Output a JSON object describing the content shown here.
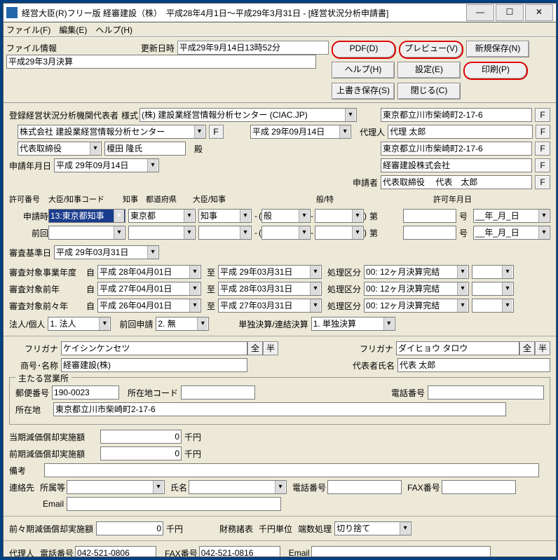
{
  "title": "経営大臣(R)フリー版 経審建設（株）　平成28年4月1日～平成29年3月31日 - [経営状況分析申請書]",
  "menu": {
    "file": "ファイル(F)",
    "edit": "編集(E)",
    "help": "ヘルプ(H)"
  },
  "win": {
    "min": "—",
    "max": "☐",
    "close": "✕"
  },
  "fileInfo": {
    "lab": "ファイル情報",
    "udLab": "更新日時",
    "udVal": "平成29年9月14日13時52分",
    "name": "平成29年3月決算"
  },
  "tbtn": {
    "pdf": "PDF(D)",
    "preview": "プレビュー(V)",
    "newSave": "新規保存(N)",
    "helpB": "ヘルプ(H)",
    "settings": "設定(E)",
    "print": "印刷(P)",
    "overwrite": "上書き保存(S)",
    "close": "閉じる(C)"
  },
  "s1": {
    "regLab": "登録経営状況分析機関代表者",
    "fmtLab": "様式",
    "fmtVal": "(株) 建設業経営情報分析センター (CIAC.JP)",
    "addr1": "東京都立川市柴崎町2-17-6",
    "company": "株式会社  建設業経営情報分析センター",
    "date1": "平成 29年09月14日",
    "agentLab": "代理人",
    "agentVal": "代理  太郎",
    "role": "代表取締役",
    "person": "榎田  隆氏",
    "honor": "殿",
    "addr2": "東京都立川市柴崎町2-17-6",
    "appDateLab": "申請年月日",
    "appDateVal": "平成 29年09月14日",
    "clientLab": "申請者",
    "client1": "経審建設株式会社",
    "client2": "代表取締役　  代表　太郎"
  },
  "permit": {
    "numLab": "許可番号",
    "col1": "大臣/知事コード",
    "col2": "知事　都道府県",
    "col3": "大臣/知事",
    "col4": "般/特",
    "dateLab": "許可年月日",
    "rowApp": "申請時",
    "rowPrev": "前回",
    "v1": "13:東京都知事",
    "v2": "東京都",
    "v3": "知事",
    "dash": "-",
    "brO": "(",
    "brC": ")",
    "han": "般",
    "dai": "第",
    "gou": "号",
    "emptyDate": "__年_月_日"
  },
  "base": {
    "lab": "審査基準日",
    "val": "平成 29年03月31日"
  },
  "periods": {
    "jii": "自",
    "to": "至",
    "kubun": "処理区分",
    "r1": {
      "lab": "審査対象事業年度",
      "from": "平成 28年04月01日",
      "toV": "平成 29年03月31日",
      "k": "00: 12ヶ月決算完結"
    },
    "r2": {
      "lab": "審査対象前年",
      "from": "平成 27年04月01日",
      "toV": "平成 28年03月31日",
      "k": "00: 12ヶ月決算完結"
    },
    "r3": {
      "lab": "審査対象前々年",
      "from": "平成 26年04月01日",
      "toV": "平成 27年03月31日",
      "k": "00: 12ヶ月決算完結"
    }
  },
  "mid": {
    "lk": "法人/個人",
    "lv": "1. 法人",
    "pk": "前回申請",
    "pv": "2. 無",
    "sk": "単独決算/連結決算",
    "sv": "1. 単独決算"
  },
  "co": {
    "furiLab": "フリガナ",
    "furi1": "ケイシンケンセツ",
    "furi2": "ダイヒョウ  タロウ",
    "zen": "全",
    "han": "半",
    "nameLab": "商号･名称",
    "nameVal": "経審建設(株)",
    "repLab": "代表者氏名",
    "repVal": "代表  太郎",
    "officeTitle": "主たる営業所",
    "postLab": "郵便番号",
    "postVal": "190-0023",
    "codeLab": "所在地コード",
    "codeVal": "",
    "telLab": "電話番号",
    "telVal": "",
    "addrLab": "所在地",
    "addrVal": "東京都立川市柴崎町2-17-6"
  },
  "dep": {
    "cur": "当期減価償却実施額",
    "prev": "前期減価償却実施額",
    "val": "0",
    "unit": "千円"
  },
  "remark": {
    "lab": "備考"
  },
  "contact": {
    "lab": "連絡先",
    "dept": "所属等",
    "name": "氏名",
    "tel": "電話番号",
    "fax": "FAX番号",
    "email": "Email"
  },
  "fin": {
    "pp": "前々期減価償却実施額",
    "val": "0",
    "unit": "千円",
    "fs": "財務諸表",
    "fsU": "千円単位",
    "round": "端数処理",
    "roundV": "切り捨て"
  },
  "agent": {
    "lab": "代理人",
    "tel": "電話番号",
    "telV": "042-521-0806",
    "fax": "FAX番号",
    "faxV": "042-521-0816",
    "email": "Email"
  }
}
